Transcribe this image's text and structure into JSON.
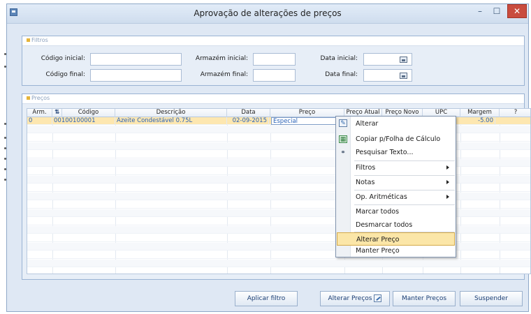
{
  "window": {
    "title": "Aprovação de alterações de preços",
    "minimize_glyph": "–",
    "maximize_glyph": "☐",
    "close_glyph": "✕"
  },
  "filters": {
    "group_title": "Filtros",
    "codigo_inicial": {
      "label": "Código inicial:",
      "value": ""
    },
    "codigo_final": {
      "label": "Código final:",
      "value": ""
    },
    "armazem_inicial": {
      "label": "Armazém inicial:",
      "value": ""
    },
    "armazem_final": {
      "label": "Armazém final:",
      "value": ""
    },
    "data_inicial": {
      "label": "Data inicial:",
      "value": ""
    },
    "data_final": {
      "label": "Data final:",
      "value": ""
    }
  },
  "prices": {
    "group_title": "Preços",
    "columns": [
      "Arm.",
      "",
      "Código",
      "Descrição",
      "Data",
      "Preço",
      "Preço Atual",
      "Preço Novo",
      "UPC",
      "Margem",
      "?"
    ],
    "rows": [
      {
        "arm": "0",
        "codigo": "00100100001",
        "descricao": "Azeite Condestável 0.75L",
        "data": "02-09-2015",
        "preco": "Especial",
        "margem": "-5.00"
      }
    ]
  },
  "context_menu": {
    "items": [
      {
        "label": "Alterar",
        "icon": "edit-icon"
      },
      {
        "label": "Copiar p/Folha de Cálculo",
        "icon": "spreadsheet-icon"
      },
      {
        "label": "Pesquisar Texto...",
        "icon": "binoculars-icon"
      },
      {
        "label": "Filtros",
        "submenu": true
      },
      {
        "label": "Notas",
        "submenu": true
      },
      {
        "label": "Op. Aritméticas",
        "submenu": true
      },
      {
        "label": "Marcar todos"
      },
      {
        "label": "Desmarcar todos"
      },
      {
        "label": "Alterar Preço",
        "highlighted": true
      },
      {
        "label": "Manter Preço"
      }
    ]
  },
  "buttons": {
    "aplicar_filtro": "Aplicar filtro",
    "alterar_precos": "Alterar Preços",
    "manter_precos": "Manter Preços",
    "suspender": "Suspender"
  },
  "colors": {
    "window_bg": "#dfe8f4",
    "selected_row": "#fde7b0",
    "highlight_item": "#fbe6a8",
    "link_text": "#2a62b8",
    "close_button": "#c94c3e"
  }
}
